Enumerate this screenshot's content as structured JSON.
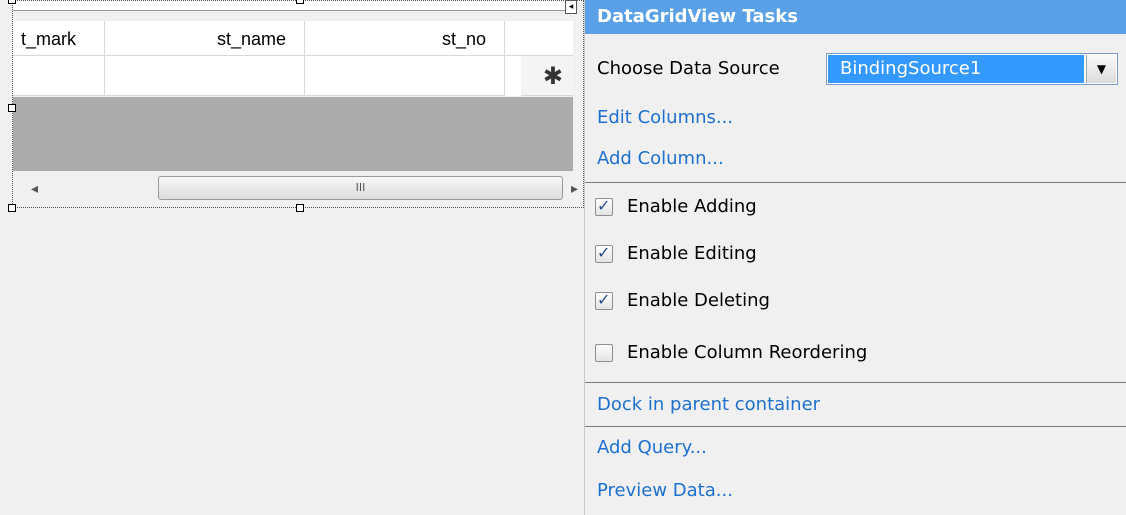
{
  "grid": {
    "columns": [
      "t_mark",
      "st_name",
      "st_no"
    ],
    "new_row_marker": "✱",
    "scroll_left": "◂",
    "scroll_right": "▸",
    "scroll_grip": "III",
    "smart_tag": "◂"
  },
  "panel": {
    "title": "DataGridView Tasks",
    "data_source_label": "Choose Data Source",
    "data_source_value": "BindingSource1",
    "combo_arrow": "▼",
    "edit_columns": "Edit Columns...",
    "add_column": "Add Column...",
    "options": [
      {
        "label": "Enable Adding",
        "checked": true
      },
      {
        "label": "Enable Editing",
        "checked": true
      },
      {
        "label": "Enable Deleting",
        "checked": true
      },
      {
        "label": "Enable Column Reordering",
        "checked": false
      }
    ],
    "check_glyph": "✓",
    "dock": "Dock in parent container",
    "add_query": "Add Query...",
    "preview_data": "Preview Data..."
  }
}
